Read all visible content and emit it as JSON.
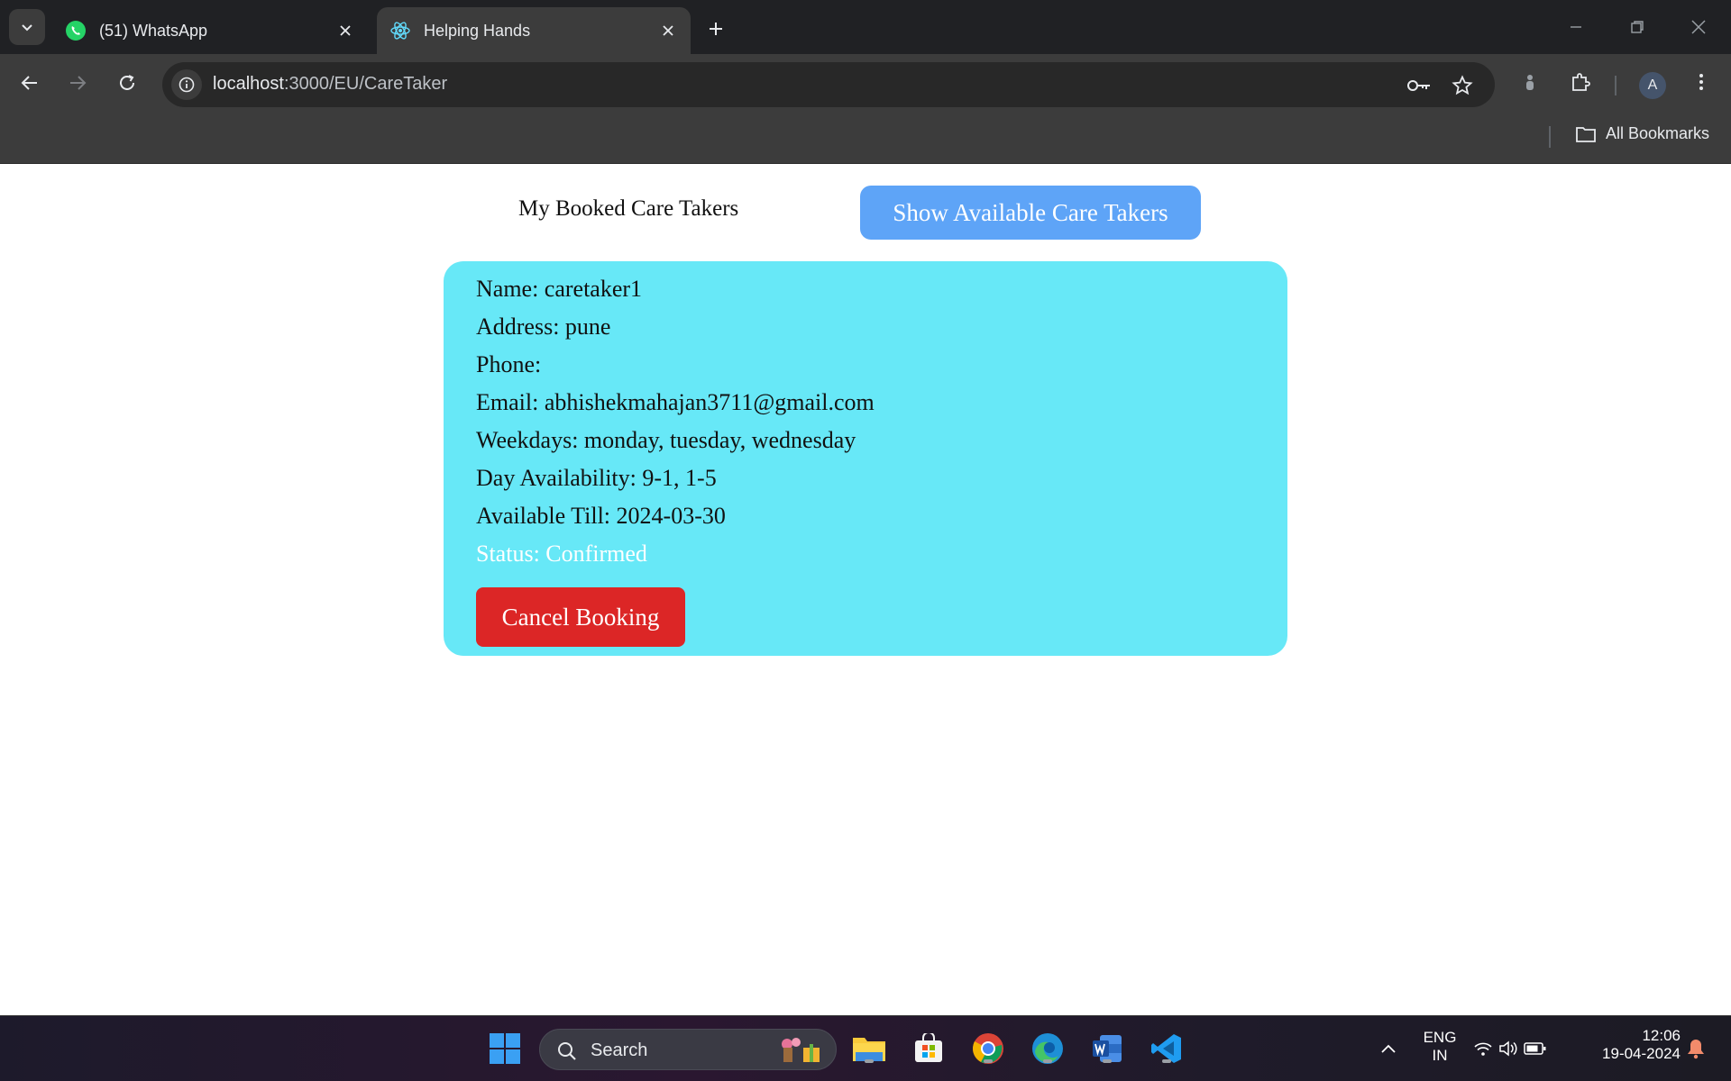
{
  "browser": {
    "tabs": [
      {
        "title": "(51) WhatsApp",
        "active": false
      },
      {
        "title": "Helping Hands",
        "active": true
      }
    ],
    "url_host": "localhost",
    "url_path": ":3000/EU/CareTaker",
    "bookmarks_label": "All Bookmarks",
    "profile_initial": "A"
  },
  "page": {
    "heading": "My Booked Care Takers",
    "show_button": "Show Available Care Takers",
    "card": {
      "name": "Name: caretaker1",
      "address": "Address: pune",
      "phone": "Phone:",
      "email": "Email: abhishekmahajan3711@gmail.com",
      "weekdays": "Weekdays: monday, tuesday, wednesday",
      "day_availability": "Day Availability: 9-1, 1-5",
      "available_till": "Available Till: 2024-03-30",
      "status": "Status: Confirmed",
      "cancel_button": "Cancel Booking"
    },
    "colors": {
      "card_bg": "#67e8f7",
      "show_button_bg": "#5ea4f7",
      "cancel_button_bg": "#dc2626",
      "status_text": "#ffffff"
    }
  },
  "taskbar": {
    "search_label": "Search",
    "language_line1": "ENG",
    "language_line2": "IN",
    "time": "12:06",
    "date": "19-04-2024"
  }
}
